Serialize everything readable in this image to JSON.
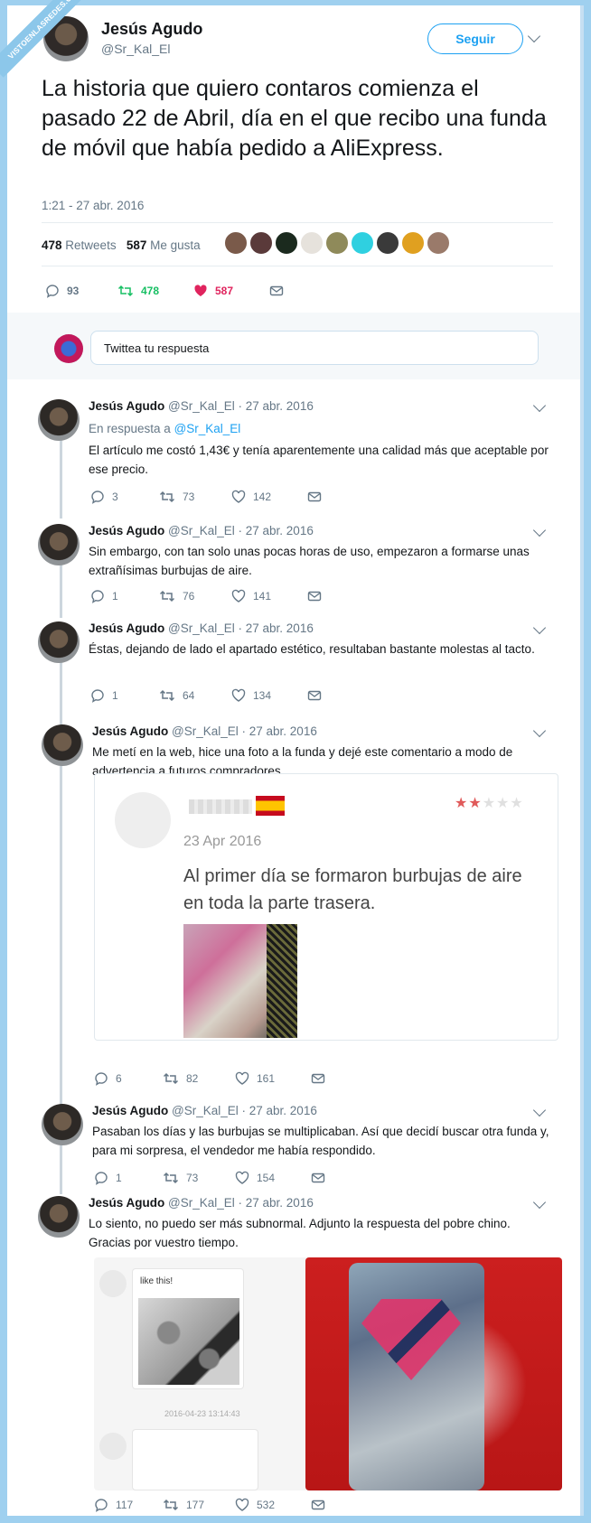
{
  "watermark": "VISTOENLASREDES.COM",
  "main": {
    "name": "Jesús Agudo",
    "handle": "@Sr_Kal_El",
    "follow_label": "Seguir",
    "text": "La historia que quiero contaros comienza el pasado 22 de Abril, día en el que recibo una funda de móvil que había pedido a AliExpress.",
    "time": "1:21 - 27 abr. 2016",
    "retweets_count": "478",
    "retweets_label": "Retweets",
    "likes_count": "587",
    "likes_label": "Me gusta",
    "replies": "93",
    "retweets": "478",
    "likes": "587"
  },
  "reply_box": {
    "placeholder": "Twittea tu respuesta"
  },
  "thread": [
    {
      "name": "Jesús Agudo",
      "meta": "@Sr_Kal_El · 27 abr. 2016",
      "reply_prefix": "En respuesta a ",
      "reply_to": "@Sr_Kal_El",
      "text": "El artículo me costó 1,43€ y tenía aparentemente una calidad más que aceptable por ese precio.",
      "replies": "3",
      "retweets": "73",
      "likes": "142"
    },
    {
      "name": "Jesús Agudo",
      "meta": "@Sr_Kal_El · 27 abr. 2016",
      "text": "Sin embargo, con tan solo unas pocas horas de uso, empezaron a formarse unas extrañísimas burbujas de aire.",
      "replies": "1",
      "retweets": "76",
      "likes": "141"
    },
    {
      "name": "Jesús Agudo",
      "meta": "@Sr_Kal_El · 27 abr. 2016",
      "text": "Éstas, dejando de lado el apartado estético, resultaban bastante molestas al tacto.",
      "replies": "1",
      "retweets": "64",
      "likes": "134"
    },
    {
      "name": "Jesús Agudo",
      "meta": "@Sr_Kal_El · 27 abr. 2016",
      "text": "Me metí en la web, hice una foto a la funda y dejé este comentario a modo de advertencia a futuros compradores.",
      "replies": "6",
      "retweets": "82",
      "likes": "161"
    },
    {
      "name": "Jesús Agudo",
      "meta": "@Sr_Kal_El · 27 abr. 2016",
      "text": "Pasaban los días y las burbujas se multiplicaban. Así que decidí buscar otra funda y, para mi sorpresa, el vendedor me había respondido.",
      "replies": "1",
      "retweets": "73",
      "likes": "154"
    },
    {
      "name": "Jesús Agudo",
      "meta": "@Sr_Kal_El · 27 abr. 2016",
      "text": "Lo siento, no puedo ser más subnormal. Adjunto la respuesta del pobre chino. Gracias por vuestro tiempo.",
      "replies": "117",
      "retweets": "177",
      "likes": "532"
    }
  ],
  "review": {
    "date": "23 Apr 2016",
    "text": "Al primer día se formaron burbujas de aire en toda la parte trasera.",
    "stars_filled": "★★",
    "stars_empty": "★★★",
    "rating_value": 2,
    "rating_max": 5
  },
  "chat": {
    "bubble_text": "like this!",
    "timestamp": "2016-04-23 13:14:43"
  },
  "colors": {
    "accent": "#1da1f2",
    "retweet_green": "#17bf63",
    "like_red": "#e0245e",
    "muted": "#657786"
  }
}
